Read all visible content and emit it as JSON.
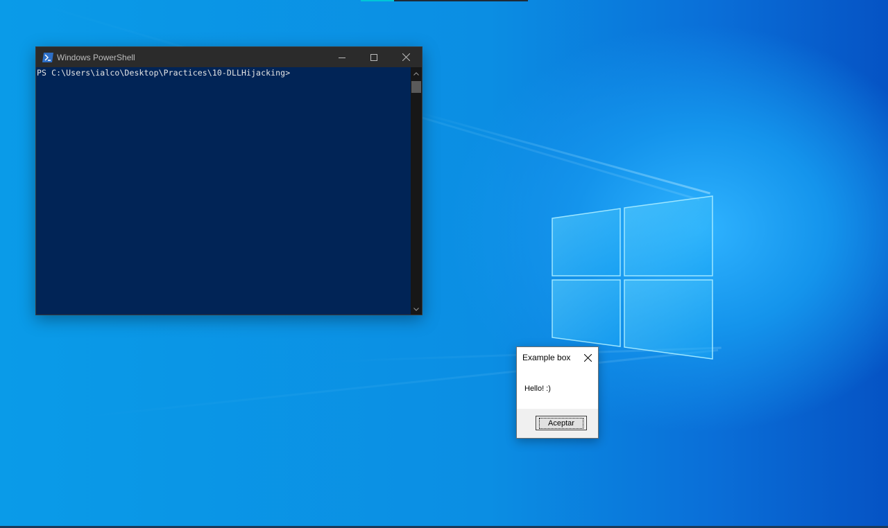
{
  "desktop": {
    "accent": "#0a8de2"
  },
  "powershell": {
    "title": "Windows PowerShell",
    "prompt_line": "PS C:\\Users\\ialco\\Desktop\\Practices\\10-DLLHijacking>",
    "background": "#012456",
    "icons": {
      "app": "powershell-icon",
      "minimize": "minimize-icon",
      "maximize": "maximize-icon",
      "close": "close-icon"
    }
  },
  "messagebox": {
    "title": "Example box",
    "message": "Hello! :)",
    "ok_label": "Aceptar"
  }
}
